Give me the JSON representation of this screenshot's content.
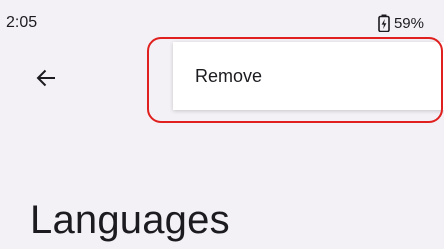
{
  "status_bar": {
    "time": "2:05",
    "battery_percent": "59%",
    "battery_icon": "battery-charging-icon"
  },
  "toolbar": {
    "back_icon": "arrow-back-icon"
  },
  "overflow_menu": {
    "items": [
      {
        "label": "Remove"
      }
    ]
  },
  "page": {
    "title": "Languages"
  },
  "colors": {
    "background": "#f3f1f5",
    "menu_background": "#ffffff",
    "highlight": "#e0201e",
    "text": "#1c1b1f"
  }
}
